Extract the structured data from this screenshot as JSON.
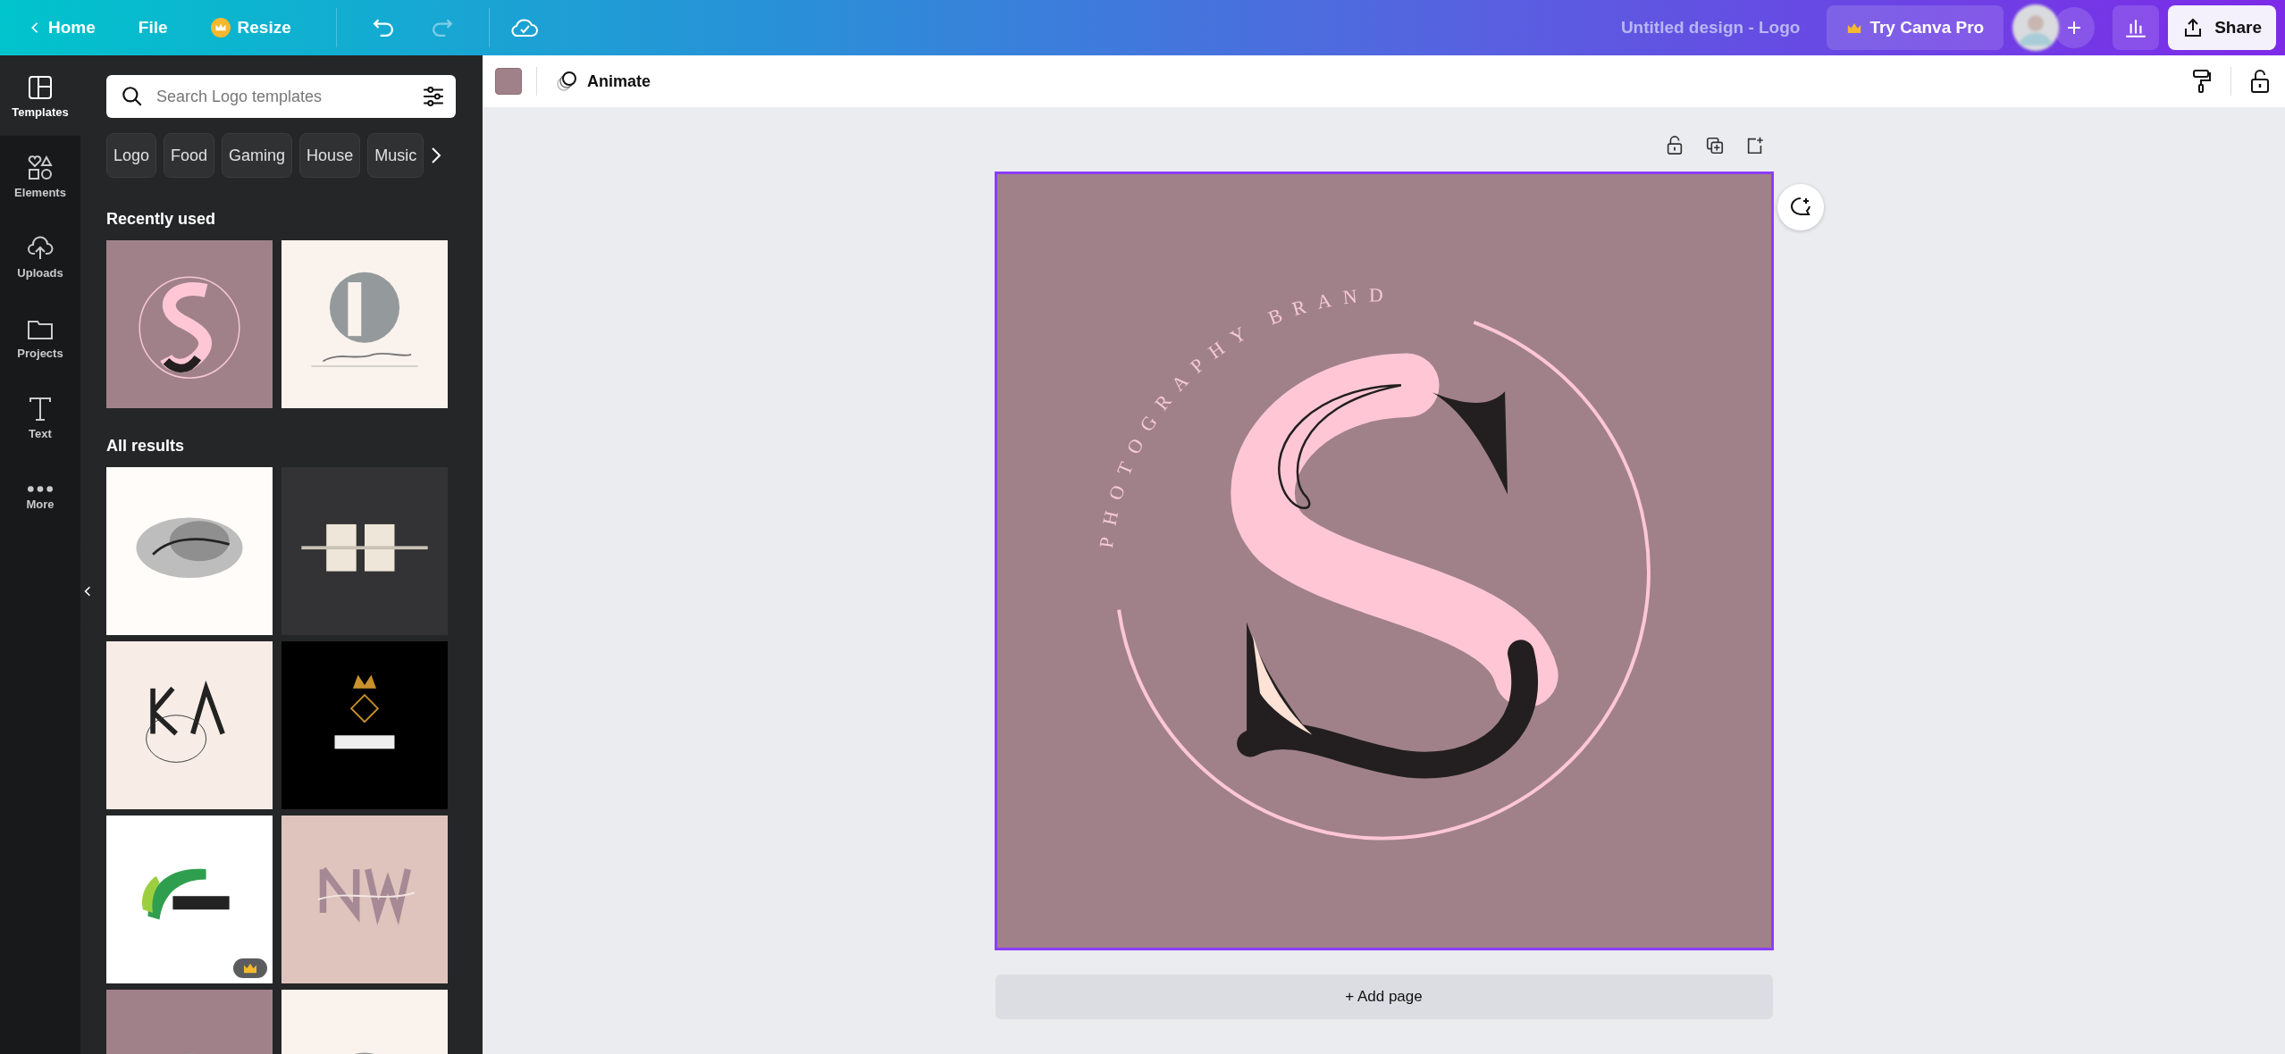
{
  "top_bar": {
    "nav": [
      {
        "kind": "back",
        "label": "Home"
      },
      {
        "kind": "plain",
        "label": "File"
      },
      {
        "kind": "pro",
        "label": "Resize"
      }
    ],
    "history": [
      {
        "kind": "undo",
        "disabled": false
      },
      {
        "kind": "redo",
        "disabled": true
      }
    ],
    "design_title": "Untitled design - Logo",
    "pro_button": "Try Canva Pro",
    "share_button": "Share"
  },
  "rail": [
    {
      "kind": "templates",
      "label": "Templates",
      "selected": true
    },
    {
      "kind": "elements",
      "label": "Elements",
      "selected": false
    },
    {
      "kind": "uploads",
      "label": "Uploads",
      "selected": false
    },
    {
      "kind": "projects",
      "label": "Projects",
      "selected": false
    },
    {
      "kind": "text",
      "label": "Text",
      "selected": false
    },
    {
      "kind": "more",
      "label": "More",
      "selected": false
    }
  ],
  "panel": {
    "search": {
      "placeholder": "Search Logo templates"
    },
    "chips": [
      "Logo",
      "Food",
      "Gaming",
      "House",
      "Music"
    ],
    "recent": {
      "heading": "Recently used",
      "items": [
        {
          "kind": "picture",
          "pro": false
        },
        {
          "kind": "picture",
          "pro": false
        }
      ]
    },
    "results": {
      "heading": "All results",
      "items": [
        {
          "kind": "picture",
          "pro": false
        },
        {
          "kind": "picture",
          "pro": false
        },
        {
          "kind": "picture",
          "pro": false
        },
        {
          "kind": "picture",
          "pro": false
        },
        {
          "kind": "picture",
          "pro": true
        },
        {
          "kind": "picture",
          "pro": false
        },
        {
          "kind": "picture"
        },
        {
          "kind": "picture"
        }
      ]
    }
  },
  "toolbar": {
    "animate": "Animate"
  },
  "design": {
    "ring_text": "PHOTOGRAPHY BRAND"
  },
  "add_page": "+ Add page"
}
